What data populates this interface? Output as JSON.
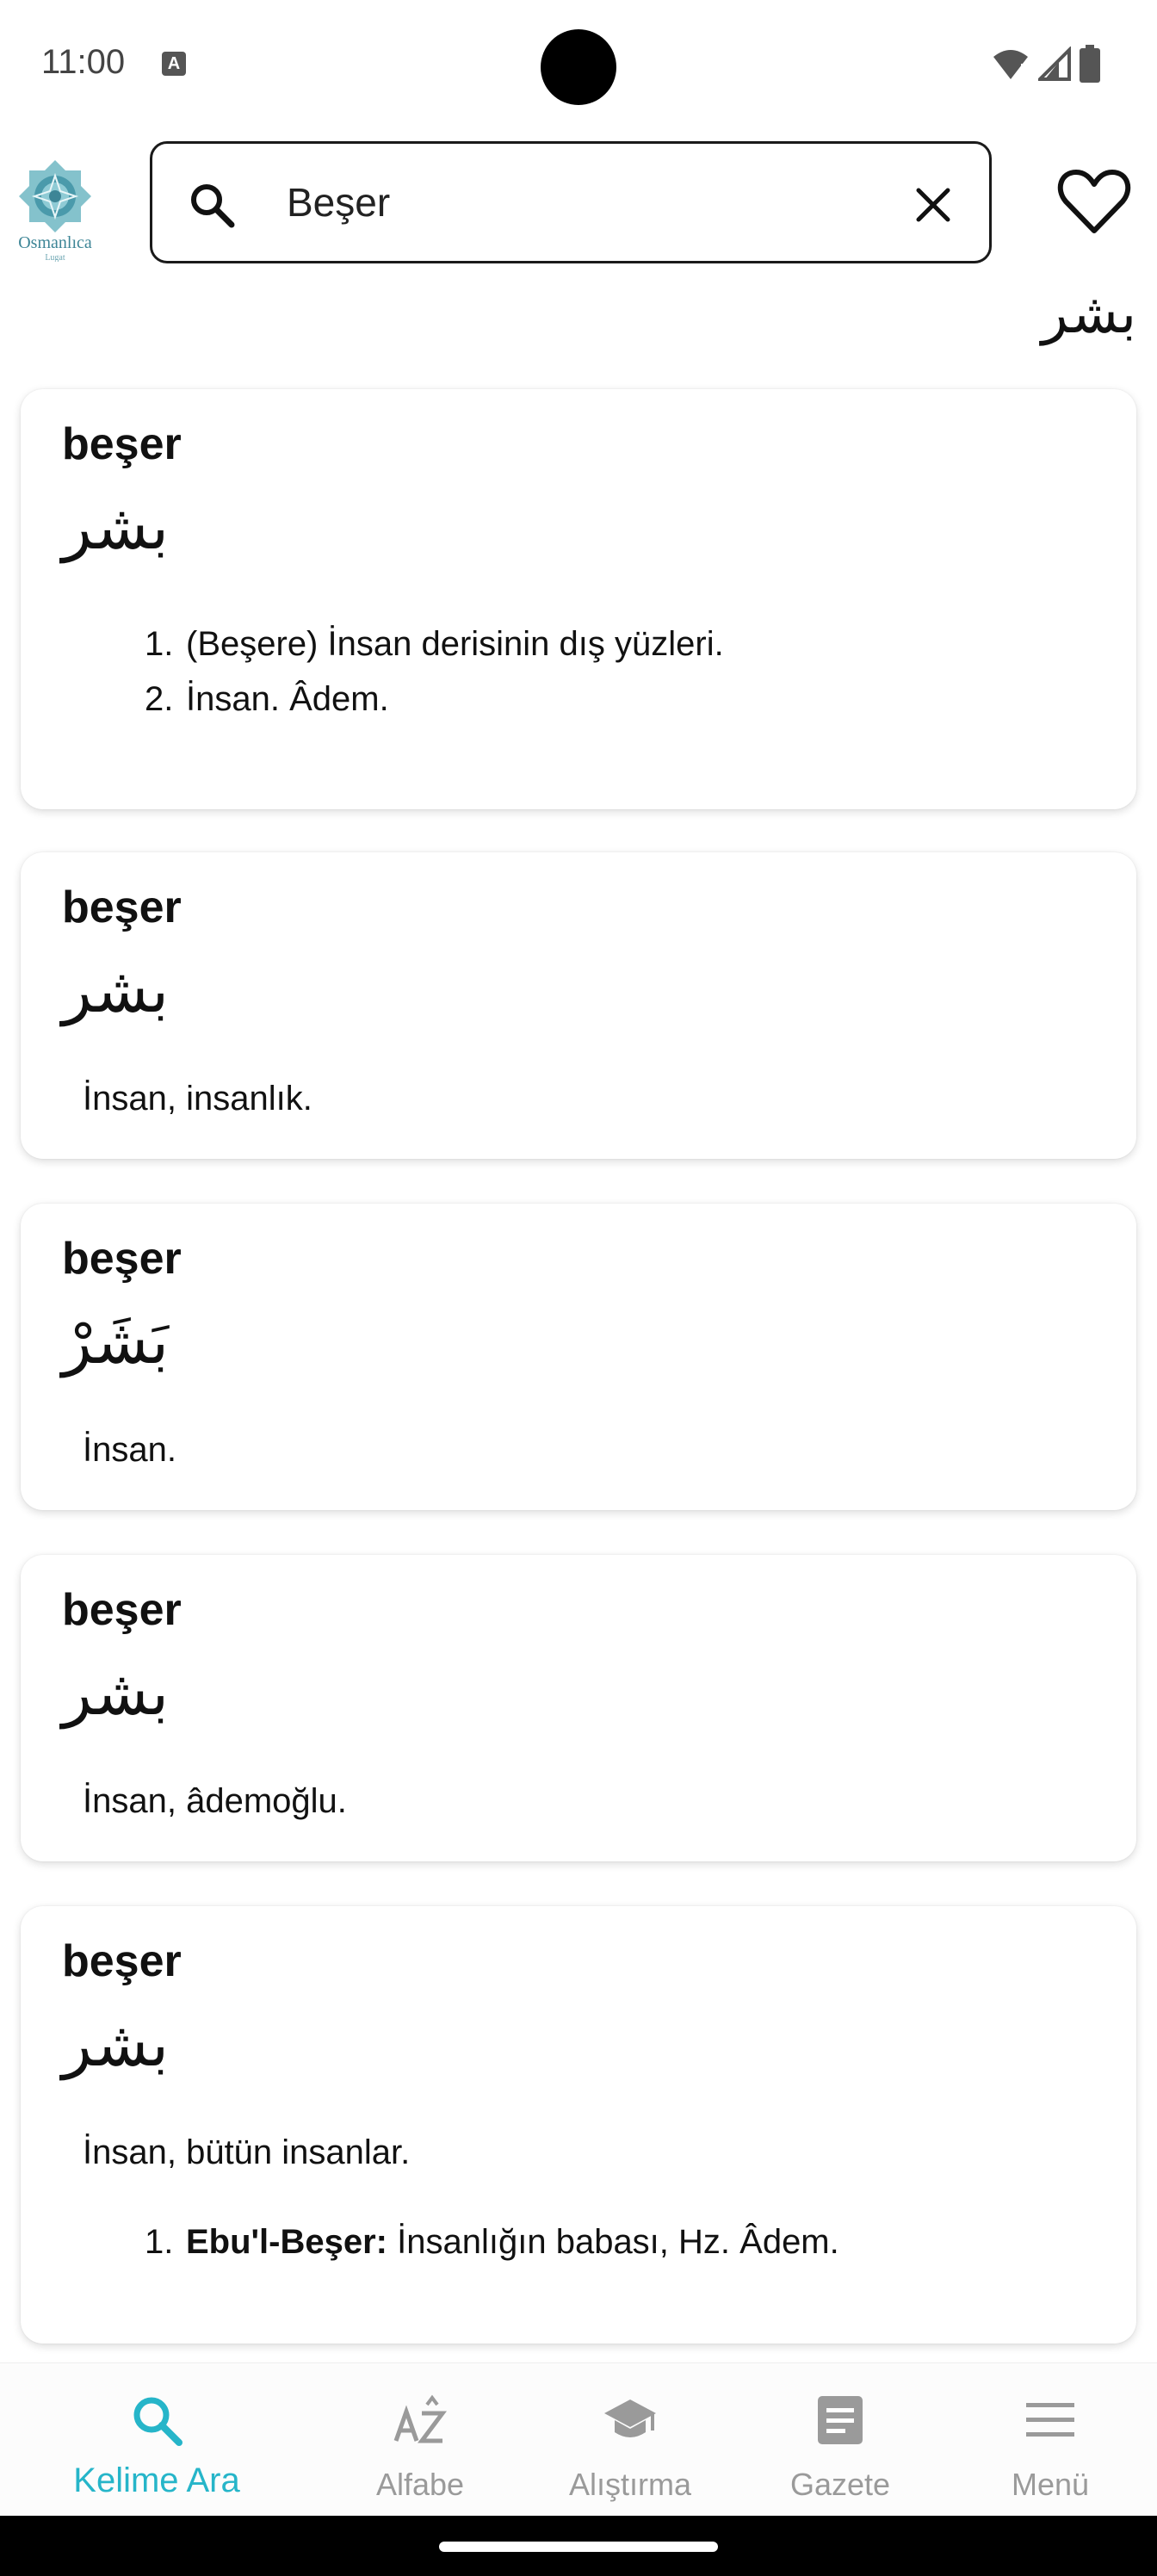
{
  "status_bar": {
    "time": "11:00",
    "notification_icon": "text-a-icon"
  },
  "header": {
    "logo_name": "Osmanlıca",
    "logo_sub": "Lugat",
    "search_value": "Beşer",
    "heart": "favorite-icon"
  },
  "arabic_query": "بشر",
  "cards": [
    {
      "word": "beşer",
      "arabic": "بشر",
      "definitions": [
        "(Beşere) İnsan derisinin dış yüzleri.",
        "İnsan. Âdem."
      ]
    },
    {
      "word": "beşer",
      "arabic": "بشر",
      "text": "İnsan, insanlık."
    },
    {
      "word": "beşer",
      "arabic": "بَشَرْ",
      "text": "İnsan."
    },
    {
      "word": "beşer",
      "arabic": "بشر",
      "text": "İnsan, âdemoğlu."
    },
    {
      "word": "beşer",
      "arabic": "بشر",
      "text": "İnsan, bütün insanlar.",
      "sub_term": "Ebu'l-Beşer:",
      "sub_def": " İnsanlığın babası, Hz. Âdem."
    }
  ],
  "nav": {
    "items": [
      {
        "label": "Kelime Ara",
        "icon": "search-icon",
        "active": true
      },
      {
        "label": "Alfabe",
        "icon": "alphabet-az-icon",
        "active": false
      },
      {
        "label": "Alıştırma",
        "icon": "graduation-cap-icon",
        "active": false
      },
      {
        "label": "Gazete",
        "icon": "article-icon",
        "active": false
      },
      {
        "label": "Menü",
        "icon": "menu-icon",
        "active": false
      }
    ]
  },
  "colors": {
    "accent": "#26b5c9",
    "inactive": "#9a9a9a"
  }
}
